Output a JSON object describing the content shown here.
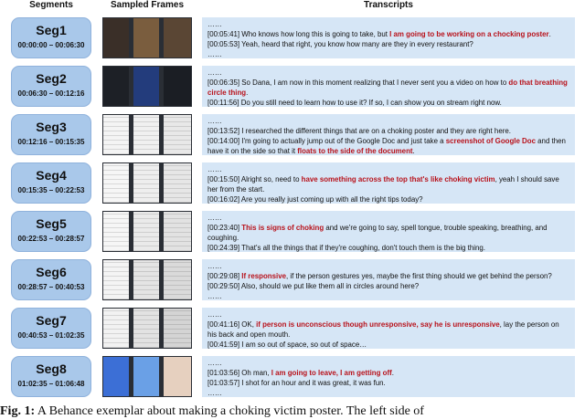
{
  "headers": {
    "segments": "Segments",
    "frames": "Sampled Frames",
    "transcripts": "Transcripts"
  },
  "ellipsis": "……",
  "segments": [
    {
      "title": "Seg1",
      "range": "00:00:00 – 00:06:30",
      "lines": [
        [
          {
            "t": "[00:05:41] Who knows how long this is going to take, but "
          },
          {
            "t": "I am going to be working on a chocking poster",
            "h": true
          },
          {
            "t": "."
          }
        ],
        [
          {
            "t": "[00:05:53] Yeah, heard that right, you know how many are they in every restaurant?"
          }
        ]
      ]
    },
    {
      "title": "Seg2",
      "range": "00:06:30 – 00:12:16",
      "lines": [
        [
          {
            "t": "[00:06:35] So Dana, I am now in this moment realizing that I never sent you a video on how to "
          },
          {
            "t": "do that breathing circle thing",
            "h": true
          },
          {
            "t": "."
          }
        ],
        [
          {
            "t": "[00:11:56] Do you still need to learn how to use it? If so, I can show you on stream right now."
          }
        ]
      ]
    },
    {
      "title": "Seg3",
      "range": "00:12:16 – 00:15:35",
      "lines": [
        [
          {
            "t": "[00:13:52] I researched the different things that are on a choking poster and they are right here."
          }
        ],
        [
          {
            "t": "[00:14:00] I'm going to actually jump out of the Google Doc and just take a "
          },
          {
            "t": "screenshot of Google Doc",
            "h": true
          },
          {
            "t": " and then have it on the side so that it "
          },
          {
            "t": "floats to the side of the document",
            "h": true
          },
          {
            "t": "."
          }
        ]
      ]
    },
    {
      "title": "Seg4",
      "range": "00:15:35 – 00:22:53",
      "lines": [
        [
          {
            "t": "[00:15:50] Alright so, need to "
          },
          {
            "t": "have something across the top that's like choking victim",
            "h": true
          },
          {
            "t": ", yeah I should save her from the start."
          }
        ],
        [
          {
            "t": "[00:16:02] Are you really just coming up with all the right tips today?"
          }
        ]
      ]
    },
    {
      "title": "Seg5",
      "range": "00:22:53 – 00:28:57",
      "lines": [
        [
          {
            "t": "[00:23:40] "
          },
          {
            "t": "This is signs of choking",
            "h": true
          },
          {
            "t": " and we're going to say, spell tongue, trouble speaking, breathing, and coughing."
          }
        ],
        [
          {
            "t": "[00:24:39] That's all the things that if they're coughing, don't touch them is the big thing."
          }
        ]
      ]
    },
    {
      "title": "Seg6",
      "range": "00:28:57 – 00:40:53",
      "lines": [
        [
          {
            "t": "[00:29:08] "
          },
          {
            "t": "If responsive",
            "h": true
          },
          {
            "t": ", if the person gestures yes, maybe the first thing should we get behind the person?"
          }
        ],
        [
          {
            "t": "[00:29:50] Also, should we put like them all in circles around here?"
          }
        ]
      ]
    },
    {
      "title": "Seg7",
      "range": "00:40:53 – 01:02:35",
      "lines": [
        [
          {
            "t": "[00:41:16] OK, "
          },
          {
            "t": "if person is unconscious though unresponsive, say he is unresponsive",
            "h": true
          },
          {
            "t": ", lay the person on his back and open mouth."
          }
        ],
        [
          {
            "t": "[00:41:59] I am so out of space, so out of space…"
          }
        ]
      ]
    },
    {
      "title": "Seg8",
      "range": "01:02:35 – 01:06:48",
      "lines": [
        [
          {
            "t": "[01:03:56] Oh man, "
          },
          {
            "t": "I am going to leave, I am getting off",
            "h": true
          },
          {
            "t": "."
          }
        ],
        [
          {
            "t": "[01:03:57] I shot for an hour and it was great, it was fun."
          }
        ]
      ]
    }
  ],
  "caption": {
    "label": "Fig. 1:",
    "text": " A Behance exemplar about making a choking victim poster. The left side of"
  }
}
